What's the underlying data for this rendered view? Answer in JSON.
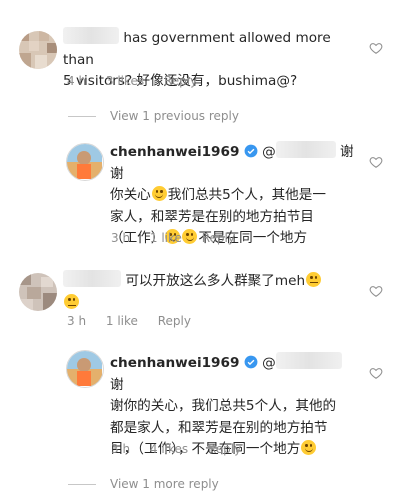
{
  "comments": [
    {
      "id": "c1",
      "text_lines": [
        "has government allowed more than",
        "5 visitors? 好像还没有，bushima@?"
      ],
      "meta": {
        "time": "4 h",
        "likes": "3 likes",
        "reply": "Reply"
      },
      "view_replies": "View 1 previous reply",
      "reply": {
        "username": "chenhanwei1969",
        "mention": "@",
        "text_lines": [
          "谢谢",
          "你关心",
          "我们总共5个人，其他是一",
          "家人，和翠芳是在别的地方拍节目",
          "（工作）",
          "不是在同一个地方"
        ],
        "meta": {
          "time": "3 h",
          "likes": "1 like",
          "reply": "Reply"
        }
      }
    },
    {
      "id": "c2",
      "text_lines": [
        "可以开放这么多人群聚了meh"
      ],
      "meta": {
        "time": "3 h",
        "likes": "1 like",
        "reply": "Reply"
      },
      "reply": {
        "username": "chenhanwei1969",
        "mention": "@",
        "text_lines": [
          "谢",
          "谢你的关心，我们总共5个人，其他的",
          "都是家人，和翠芳是在别的地方拍节",
          "目，（工作），不是在同一个地方"
        ],
        "meta": {
          "time": "3 h",
          "likes": "4 likes",
          "reply": "Reply"
        }
      },
      "view_replies": "View 1 more reply"
    }
  ],
  "colors": {
    "text": "#262626",
    "secondary": "#8e8e8e",
    "verified": "#3897f0",
    "emoji": "#ffcc33"
  }
}
